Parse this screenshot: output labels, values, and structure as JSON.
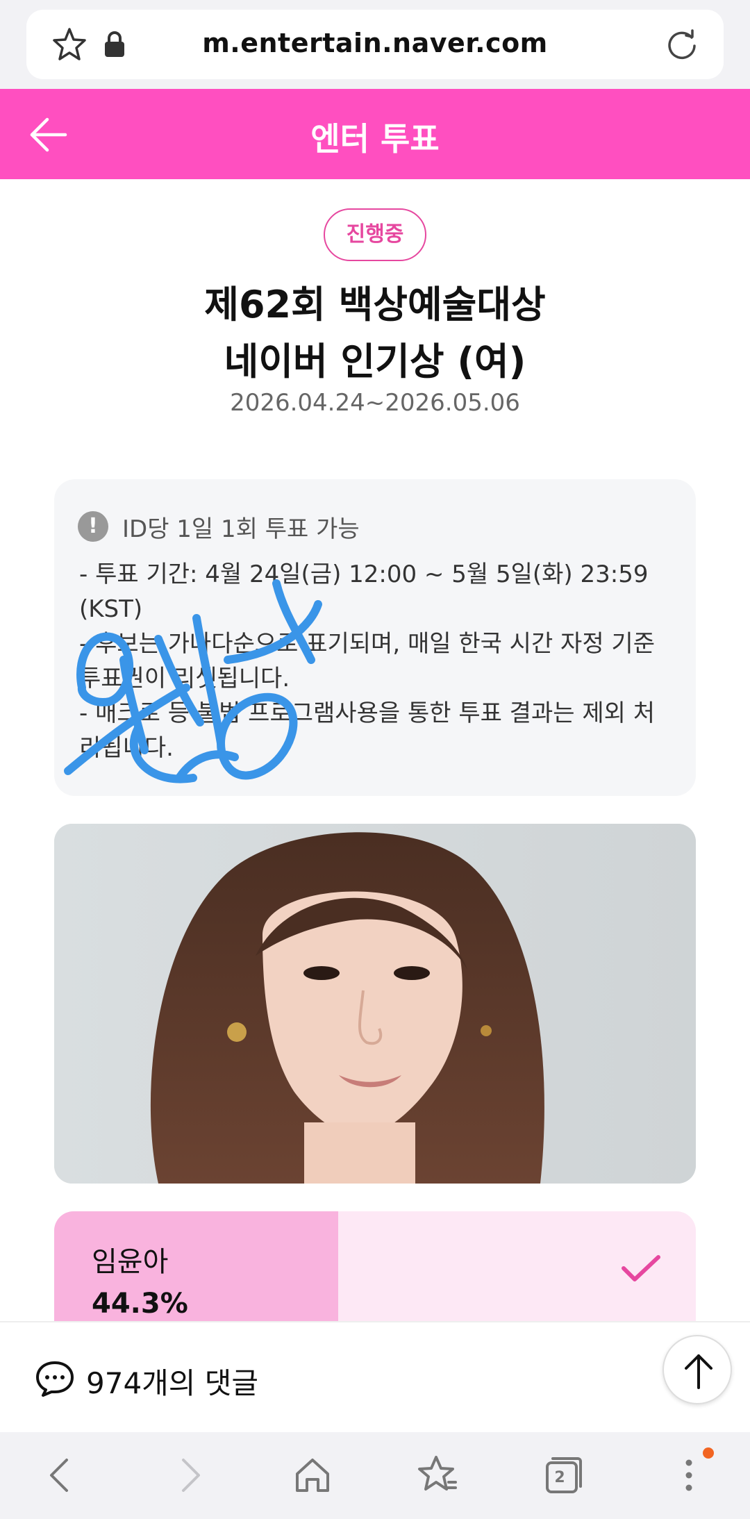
{
  "browser": {
    "url": "m.entertain.naver.com",
    "tab_count": "2"
  },
  "header": {
    "title": "엔터 투표"
  },
  "vote": {
    "status": "진행중",
    "title_line1": "제62회 백상예술대상",
    "title_line2": "네이버 인기상 (여)",
    "period": "2026.04.24~2026.05.06"
  },
  "notice": {
    "headline": "ID당 1일 1회 투표 가능",
    "lines": [
      "- 투표 기간: 4월 24일(금) 12:00 ~ 5월 5일(화) 23:59 (KST)",
      "- 후보는 가나다순으로 표기되며, 매일 한국 시간 자정 기준 투표권이 리셋됩니다.",
      "- 매크로 등 불법 프로그램사용을 통한 투표 결과는 제외 처리됩니다."
    ]
  },
  "candidate": {
    "name": "임윤아",
    "percent_label": "44.3%",
    "percent_value": 44.3
  },
  "comments": {
    "label": "974개의 댓글"
  },
  "colors": {
    "brand_pink": "#ff4fc0",
    "result_fill": "#f9b3de",
    "result_bg": "#fde8f5",
    "scribble_blue": "#3a95e8"
  },
  "icons": [
    "star-icon",
    "lock-icon",
    "reload-icon",
    "back-arrow-icon",
    "warning-icon",
    "check-icon",
    "chat-icon",
    "arrow-up-icon",
    "nav-back-icon",
    "nav-forward-icon",
    "home-icon",
    "bookmark-star-icon",
    "tabs-icon",
    "menu-dots-icon"
  ]
}
